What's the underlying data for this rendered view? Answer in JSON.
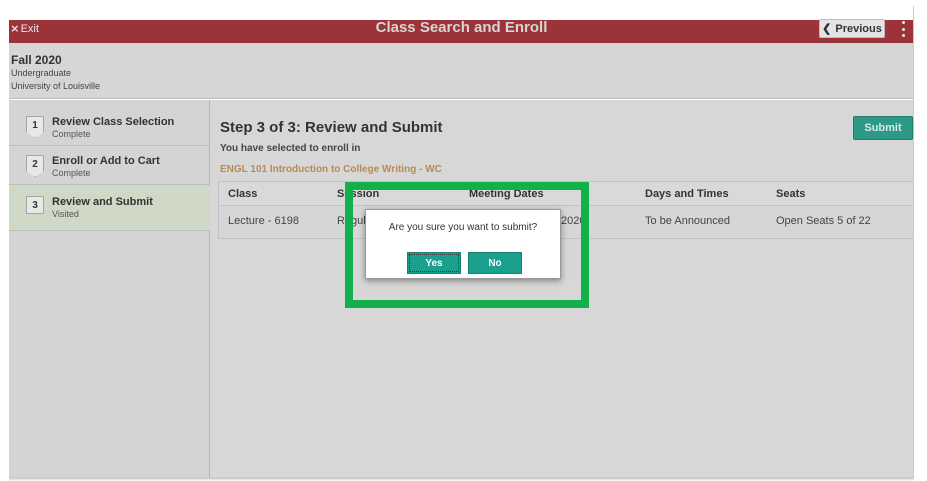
{
  "header": {
    "exit_label": "Exit",
    "title": "Class Search and Enroll",
    "previous_label": "Previous"
  },
  "term": {
    "name": "Fall 2020",
    "career": "Undergraduate",
    "institution": "University of Louisville"
  },
  "steps": [
    {
      "number": "1",
      "name": "Review Class Selection",
      "status": "Complete"
    },
    {
      "number": "2",
      "name": "Enroll or Add to Cart",
      "status": "Complete"
    },
    {
      "number": "3",
      "name": "Review and Submit",
      "status": "Visited"
    }
  ],
  "main": {
    "heading": "Step 3 of 3: Review and Submit",
    "submit_label": "Submit",
    "selected_text": "You have selected to enroll in",
    "course": "ENGL 101   Introduction to College Writing - WC"
  },
  "table": {
    "headers": [
      "Class",
      "Session",
      "Meeting Dates",
      "Days and Times",
      "Seats"
    ],
    "row": {
      "class": "Lecture - 6198",
      "session": "Regular",
      "meeting_dates": "2020",
      "days_times": "To be Announced",
      "seats": "Open Seats 5 of 22"
    }
  },
  "dialog": {
    "message": "Are you sure you want to submit?",
    "yes_label": "Yes",
    "no_label": "No"
  },
  "colors": {
    "header_bar": "#9c3338",
    "accent_teal": "#1aa08d",
    "highlight_green": "#11b04a"
  }
}
